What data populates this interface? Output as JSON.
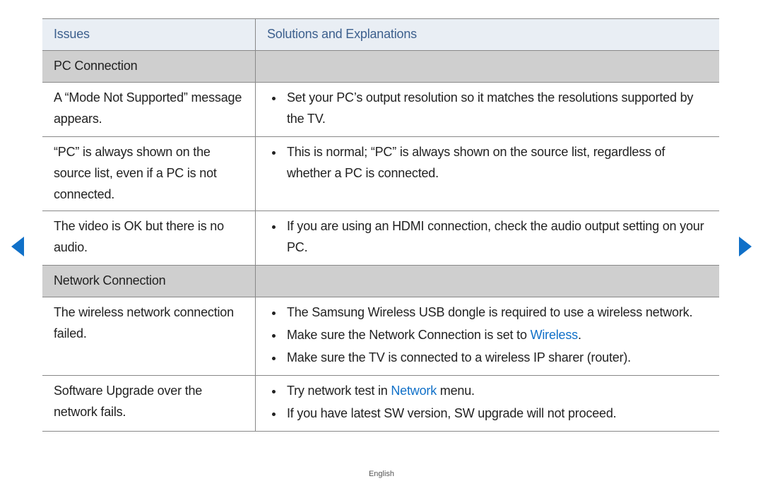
{
  "header": {
    "issues": "Issues",
    "solutions": "Solutions and Explanations"
  },
  "sections": {
    "pc": {
      "title": "PC Connection"
    },
    "net": {
      "title": "Network Connection"
    }
  },
  "rows": {
    "mode": {
      "issue": "A “Mode Not Supported” message appears.",
      "sol1": "Set your PC’s output resolution so it matches the resolutions supported by the TV."
    },
    "pc_shown": {
      "issue": "“PC” is always shown on the source list, even if a PC is not connected.",
      "sol1": "This is normal; “PC” is always shown on the source list, regardless of whether a PC is connected."
    },
    "no_audio": {
      "issue": "The video is OK but there is no audio.",
      "sol1": "If you are using an HDMI connection, check the audio output setting on your PC."
    },
    "wireless_fail": {
      "issue": "The wireless network connection failed.",
      "sol1": "The Samsung Wireless USB dongle is required to use a wireless network.",
      "sol2a": "Make sure the Network Connection is set to ",
      "sol2b": "Wireless",
      "sol2c": ".",
      "sol3": "Make sure the TV is connected to a wireless IP sharer (router)."
    },
    "sw_upgrade": {
      "issue": "Software Upgrade over the network fails.",
      "sol1a": "Try network test in ",
      "sol1b": "Network",
      "sol1c": " menu.",
      "sol2": "If you have latest SW version, SW upgrade will not proceed."
    }
  },
  "footer": {
    "lang": "English"
  }
}
